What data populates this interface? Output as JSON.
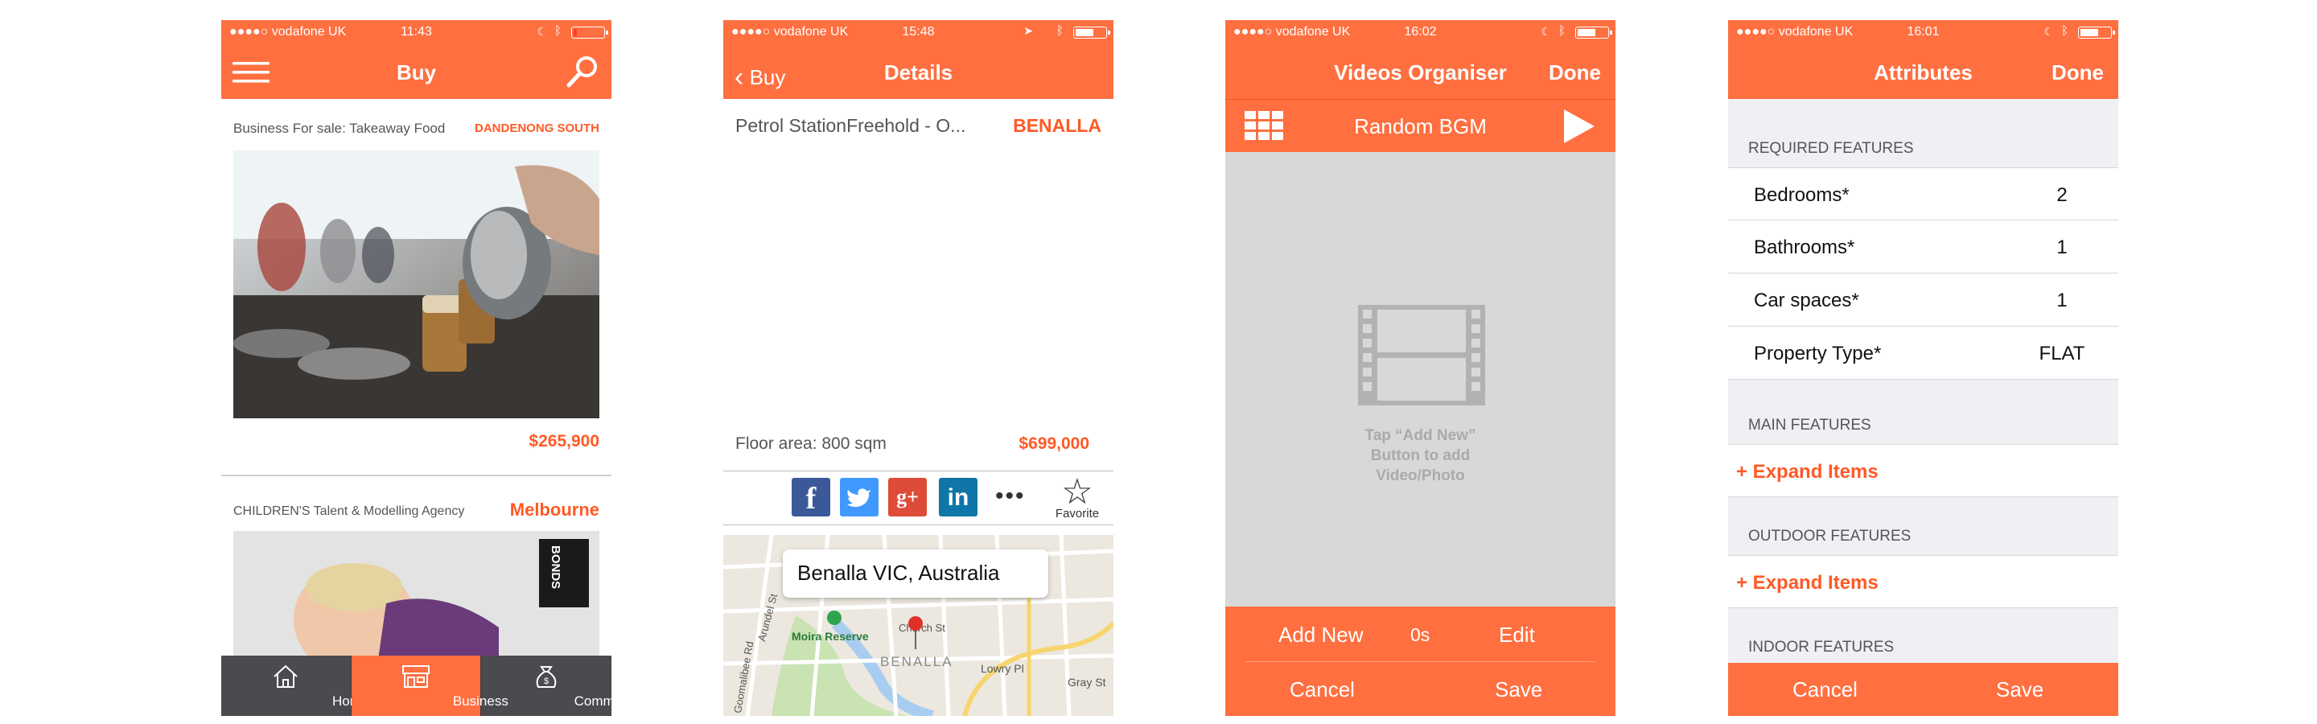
{
  "screen1": {
    "status": {
      "carrier": "●●●●○ vodafone UK",
      "time": "11:43"
    },
    "nav": {
      "title": "Buy"
    },
    "listings": [
      {
        "caption": "Business For sale: Takeaway Food",
        "location": "DANDENONG SOUTH",
        "price": "$265,900"
      },
      {
        "caption": "CHILDREN'S Talent & Modelling Agency",
        "location": "Melbourne",
        "badge": "BONDS"
      }
    ],
    "tabs": [
      {
        "label": "Home"
      },
      {
        "label": "Business"
      },
      {
        "label": "Commercial"
      }
    ]
  },
  "screen2": {
    "status": {
      "carrier": "●●●●○ vodafone UK",
      "time": "15:48"
    },
    "nav": {
      "back": "Buy",
      "title": "Details"
    },
    "detail_title": "Petrol StationFreehold - O...",
    "detail_location": "BENALLA",
    "floor_area": "Floor area:  800 sqm",
    "price": "$699,000",
    "favorite_label": "Favorite",
    "map": {
      "bubble": "Benalla VIC, Australia",
      "labels": [
        "Moira Reserve",
        "BENALLA",
        "Lowry Pl",
        "Gray St",
        "Arundel St",
        "Church St",
        "Goomalibee Rd"
      ]
    }
  },
  "screen3": {
    "status": {
      "carrier": "●●●●○ vodafone UK",
      "time": "16:02"
    },
    "nav": {
      "title": "Videos Organiser",
      "done": "Done"
    },
    "toolbar_title": "Random BGM",
    "hint_lines": [
      "Tap “Add New”",
      "Button to add",
      "Video/Photo"
    ],
    "actions": {
      "add_new": "Add New",
      "duration": "0s",
      "edit": "Edit",
      "cancel": "Cancel",
      "save": "Save"
    }
  },
  "screen4": {
    "status": {
      "carrier": "●●●●○ vodafone UK",
      "time": "16:01"
    },
    "nav": {
      "title": "Attributes",
      "done": "Done"
    },
    "sections": {
      "required": "REQUIRED FEATURES",
      "main": "MAIN FEATURES",
      "outdoor": "OUTDOOR FEATURES",
      "indoor": "INDOOR FEATURES"
    },
    "required_rows": [
      {
        "label": "Bedrooms*",
        "value": "2"
      },
      {
        "label": "Bathrooms*",
        "value": "1"
      },
      {
        "label": "Car spaces*",
        "value": "1"
      },
      {
        "label": "Property Type*",
        "value": "FLAT"
      }
    ],
    "expand_label": "+ Expand Items",
    "actions": {
      "cancel": "Cancel",
      "save": "Save"
    }
  },
  "colors": {
    "accent": "#ff6f40",
    "accent_text": "#ff5a26",
    "tabbar": "#4a4a4f"
  }
}
